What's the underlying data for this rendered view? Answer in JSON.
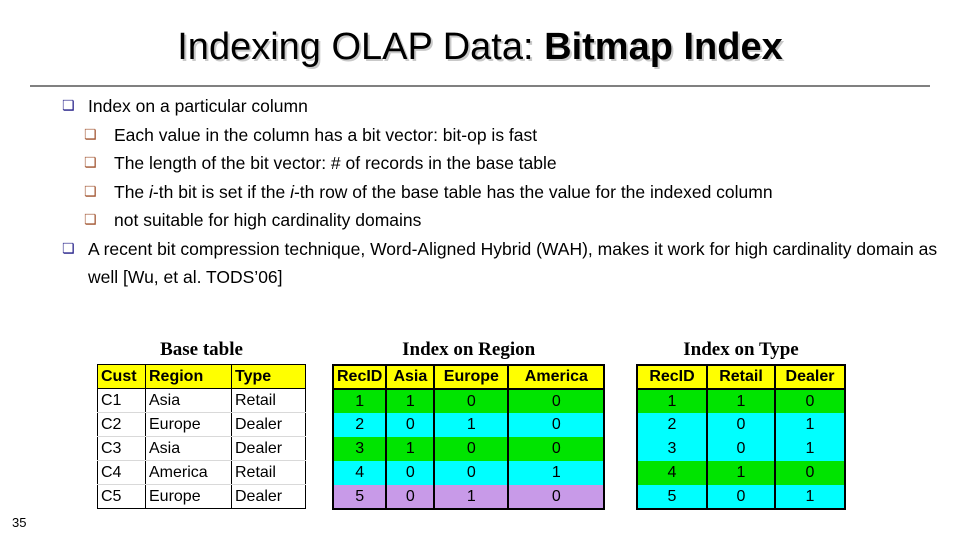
{
  "slide": {
    "title_main": "Indexing OLAP Data: ",
    "title_emphasis": "Bitmap Index",
    "page_number": "35"
  },
  "bullets": [
    {
      "level": 1,
      "marker": "❏",
      "text": "Index on a particular column"
    },
    {
      "level": 2,
      "marker": "❏",
      "text": "Each value in the column has a bit vector: bit-op is fast"
    },
    {
      "level": 2,
      "marker": "❏",
      "text": "The length of the bit vector: # of records in the base table"
    },
    {
      "level": 2,
      "marker": "❏",
      "text_parts": [
        {
          "t": "The  "
        },
        {
          "t": "i",
          "italic": true
        },
        {
          "t": "-th bit is set if the  "
        },
        {
          "t": "i",
          "italic": true
        },
        {
          "t": "-th row of the base table has the value for the indexed column"
        }
      ]
    },
    {
      "level": 2,
      "marker": "❏",
      "text": "not suitable for high cardinality domains"
    },
    {
      "level": 1,
      "marker": "❏",
      "text": "A recent bit compression technique, Word-Aligned Hybrid (WAH), makes it work for high cardinality domain as well [Wu, et al. TODS’06]"
    }
  ],
  "tables": {
    "base": {
      "caption": "Base table",
      "headers": [
        "Cust",
        "Region",
        "Type"
      ],
      "rows": [
        [
          "C1",
          "Asia",
          "Retail"
        ],
        [
          "C2",
          "Europe",
          "Dealer"
        ],
        [
          "C3",
          "Asia",
          "Dealer"
        ],
        [
          "C4",
          "America",
          "Retail"
        ],
        [
          "C5",
          "Europe",
          "Dealer"
        ]
      ]
    },
    "index_region": {
      "caption": "Index on Region",
      "headers": [
        "RecID",
        "Asia",
        "Europe",
        "America"
      ],
      "rows": [
        {
          "cells": [
            "1",
            "1",
            "0",
            "0"
          ],
          "color": "green"
        },
        {
          "cells": [
            "2",
            "0",
            "1",
            "0"
          ],
          "color": "cyan"
        },
        {
          "cells": [
            "3",
            "1",
            "0",
            "0"
          ],
          "color": "green"
        },
        {
          "cells": [
            "4",
            "0",
            "0",
            "1"
          ],
          "color": "cyan"
        },
        {
          "cells": [
            "5",
            "0",
            "1",
            "0"
          ],
          "color": "purple"
        }
      ]
    },
    "index_type": {
      "caption": "Index on Type",
      "headers": [
        "RecID",
        "Retail",
        "Dealer"
      ],
      "rows": [
        {
          "cells": [
            "1",
            "1",
            "0"
          ],
          "color": "green"
        },
        {
          "cells": [
            "2",
            "0",
            "1"
          ],
          "color": "cyan"
        },
        {
          "cells": [
            "3",
            "0",
            "1"
          ],
          "color": "cyan"
        },
        {
          "cells": [
            "4",
            "1",
            "0"
          ],
          "color": "green"
        },
        {
          "cells": [
            "5",
            "0",
            "1"
          ],
          "color": "cyan"
        }
      ]
    }
  },
  "colors": {
    "header_yellow": "#ffff00",
    "row_green": "#00e400",
    "row_cyan": "#00ffff",
    "row_purple": "#c89ae8",
    "bullet_level1": "#1f1a86",
    "bullet_level2": "#a0522d",
    "rule_gray": "#808080"
  }
}
